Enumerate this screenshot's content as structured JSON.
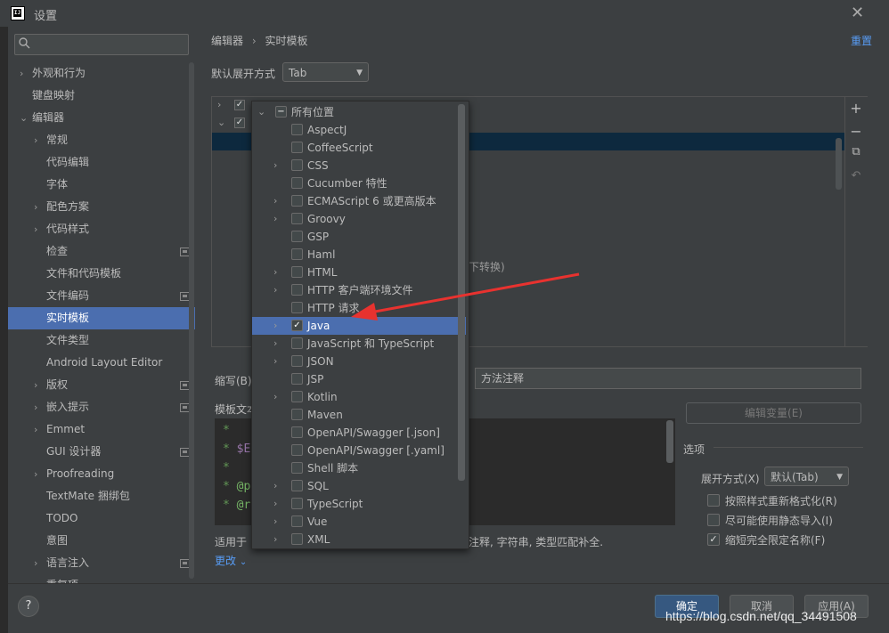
{
  "window": {
    "title": "设置",
    "app_icon_text": "IJ"
  },
  "sidebar": {
    "search_placeholder": "",
    "items": [
      {
        "label": "外观和行为"
      },
      {
        "label": "键盘映射"
      },
      {
        "label": "编辑器"
      },
      {
        "label": "常规"
      },
      {
        "label": "代码编辑"
      },
      {
        "label": "字体"
      },
      {
        "label": "配色方案"
      },
      {
        "label": "代码样式"
      },
      {
        "label": "检查"
      },
      {
        "label": "文件和代码模板"
      },
      {
        "label": "文件编码"
      },
      {
        "label": "实时模板"
      },
      {
        "label": "文件类型"
      },
      {
        "label": "Android Layout Editor"
      },
      {
        "label": "版权"
      },
      {
        "label": "嵌入提示"
      },
      {
        "label": "Emmet"
      },
      {
        "label": "GUI 设计器"
      },
      {
        "label": "Proofreading"
      },
      {
        "label": "TextMate 捆绑包"
      },
      {
        "label": "TODO"
      },
      {
        "label": "意图"
      },
      {
        "label": "语言注入"
      },
      {
        "label": "重复项"
      }
    ]
  },
  "breadcrumb": {
    "parent": "编辑器",
    "separator": "›",
    "current": "实时模板"
  },
  "reset_label": "重置",
  "expand": {
    "label": "默认展开方式",
    "value": "Tab"
  },
  "template_list": {
    "partial_hint": "下转换)"
  },
  "abbrev": {
    "label": "缩写(B)",
    "description_value": "方法注释"
  },
  "template_text_label": "模板文本",
  "edit_vars_label": "编辑变量(E)",
  "editor": {
    "lines": [
      {
        "prefix": " *",
        "var": "",
        "rest": ""
      },
      {
        "prefix": "* ",
        "var": "$E",
        "rest": ""
      },
      {
        "prefix": "*",
        "var": "",
        "rest": ""
      },
      {
        "prefix": "* ",
        "var": "",
        "tag": "@p",
        "rest": ""
      },
      {
        "prefix": "* ",
        "var": "",
        "tag": "@r",
        "rest": ""
      }
    ]
  },
  "applicable": {
    "prefix": "适用于",
    "rest": "注释, 字符串, 类型匹配补全.",
    "change_label": "更改"
  },
  "options": {
    "title": "选项",
    "expand_label": "展开方式(X)",
    "expand_value": "默认(Tab)",
    "checks": [
      {
        "label": "按照样式重新格式化(R)",
        "checked": false
      },
      {
        "label": "尽可能使用静态导入(I)",
        "checked": false
      },
      {
        "label": "缩短完全限定名称(F)",
        "checked": true
      }
    ]
  },
  "footer": {
    "ok": "确定",
    "cancel": "取消",
    "apply": "应用(A)",
    "help": "?"
  },
  "watermark": "https://blog.csdn.net/qq_34491508",
  "popup": {
    "items": [
      {
        "label": "所有位置",
        "expandable": true,
        "state": "partial"
      },
      {
        "label": "AspectJ",
        "expandable": false,
        "state": "unchecked"
      },
      {
        "label": "CoffeeScript",
        "expandable": false,
        "state": "unchecked"
      },
      {
        "label": "CSS",
        "expandable": true,
        "state": "unchecked"
      },
      {
        "label": "Cucumber 特性",
        "expandable": false,
        "state": "unchecked"
      },
      {
        "label": "ECMAScript 6 或更高版本",
        "expandable": true,
        "state": "unchecked"
      },
      {
        "label": "Groovy",
        "expandable": true,
        "state": "unchecked"
      },
      {
        "label": "GSP",
        "expandable": false,
        "state": "unchecked"
      },
      {
        "label": "Haml",
        "expandable": false,
        "state": "unchecked"
      },
      {
        "label": "HTML",
        "expandable": true,
        "state": "unchecked"
      },
      {
        "label": "HTTP 客户端环境文件",
        "expandable": true,
        "state": "unchecked"
      },
      {
        "label": "HTTP 请求",
        "expandable": false,
        "state": "unchecked"
      },
      {
        "label": "Java",
        "expandable": true,
        "state": "checked"
      },
      {
        "label": "JavaScript 和 TypeScript",
        "expandable": true,
        "state": "unchecked"
      },
      {
        "label": "JSON",
        "expandable": true,
        "state": "unchecked"
      },
      {
        "label": "JSP",
        "expandable": false,
        "state": "unchecked"
      },
      {
        "label": "Kotlin",
        "expandable": true,
        "state": "unchecked"
      },
      {
        "label": "Maven",
        "expandable": false,
        "state": "unchecked"
      },
      {
        "label": "OpenAPI/Swagger [.json]",
        "expandable": false,
        "state": "unchecked"
      },
      {
        "label": "OpenAPI/Swagger [.yaml]",
        "expandable": false,
        "state": "unchecked"
      },
      {
        "label": "Shell 脚本",
        "expandable": false,
        "state": "unchecked"
      },
      {
        "label": "SQL",
        "expandable": true,
        "state": "unchecked"
      },
      {
        "label": "TypeScript",
        "expandable": true,
        "state": "unchecked"
      },
      {
        "label": "Vue",
        "expandable": true,
        "state": "unchecked"
      },
      {
        "label": "XML",
        "expandable": true,
        "state": "unchecked"
      }
    ]
  },
  "colors": {
    "accent": "#4b6eaf",
    "link": "#589df6",
    "arrow": "#e8322f"
  }
}
